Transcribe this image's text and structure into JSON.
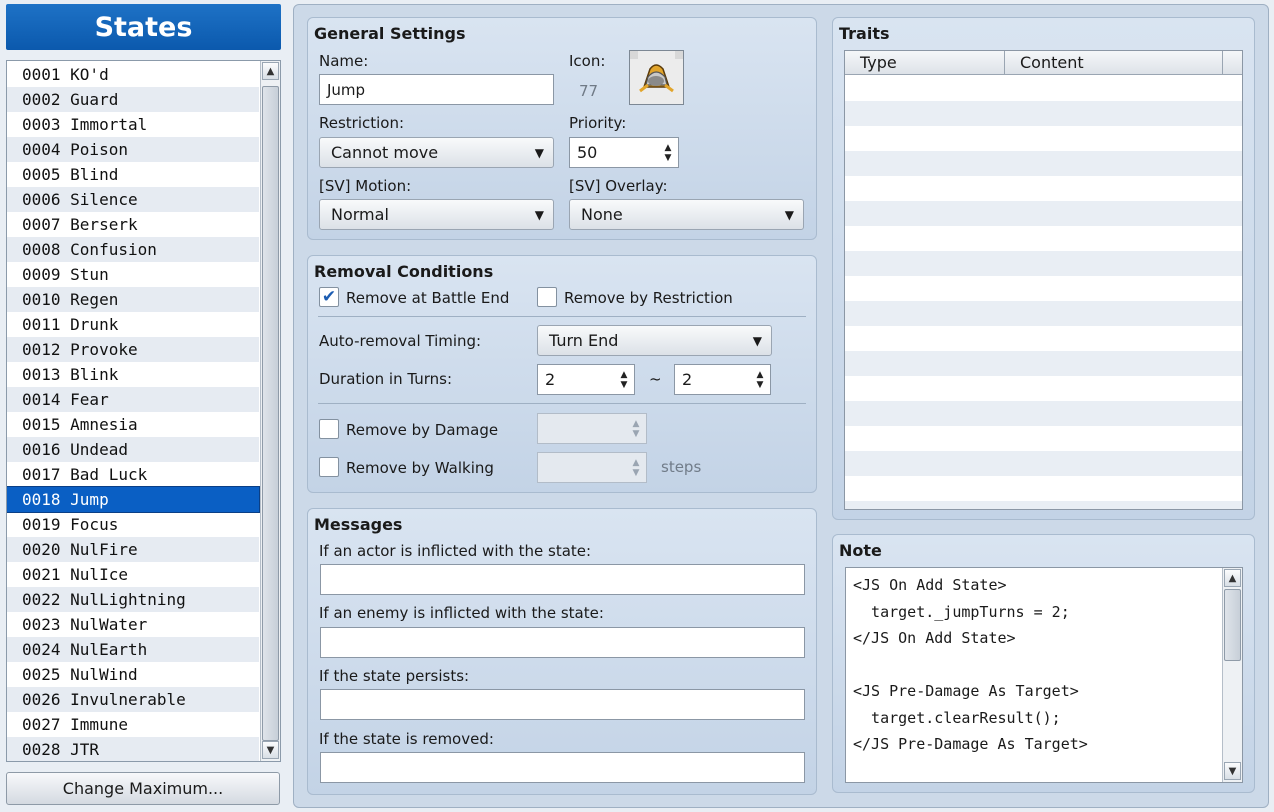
{
  "list": {
    "title": "States",
    "items": [
      "0001 KO'd",
      "0002 Guard",
      "0003 Immortal",
      "0004 Poison",
      "0005 Blind",
      "0006 Silence",
      "0007 Berserk",
      "0008 Confusion",
      "0009 Stun",
      "0010 Regen",
      "0011 Drunk",
      "0012 Provoke",
      "0013 Blink",
      "0014 Fear",
      "0015 Amnesia",
      "0016 Undead",
      "0017 Bad Luck",
      "0018 Jump",
      "0019 Focus",
      "0020 NulFire",
      "0021 NulIce",
      "0022 NulLightning",
      "0023 NulWater",
      "0024 NulEarth",
      "0025 NulWind",
      "0026 Invulnerable",
      "0027 Immune",
      "0028 JTR"
    ],
    "selected_index": 17,
    "change_max_label": "Change Maximum..."
  },
  "general": {
    "title": "General Settings",
    "name_label": "Name:",
    "name_value": "Jump",
    "icon_label": "Icon:",
    "icon_index": "77",
    "restriction_label": "Restriction:",
    "restriction_value": "Cannot move",
    "priority_label": "Priority:",
    "priority_value": "50",
    "motion_label": "[SV] Motion:",
    "motion_value": "Normal",
    "overlay_label": "[SV] Overlay:",
    "overlay_value": "None"
  },
  "removal": {
    "title": "Removal Conditions",
    "battle_end_label": "Remove at Battle End",
    "battle_end_checked": true,
    "restriction_label": "Remove by Restriction",
    "restriction_checked": false,
    "timing_label": "Auto-removal Timing:",
    "timing_value": "Turn End",
    "duration_label": "Duration in Turns:",
    "duration_min": "2",
    "duration_max": "2",
    "tilde": "~",
    "damage_label": "Remove by Damage",
    "damage_checked": false,
    "walking_label": "Remove by Walking",
    "walking_checked": false,
    "steps_label": "steps"
  },
  "messages": {
    "title": "Messages",
    "actor_label": "If an actor is inflicted with the state:",
    "actor_value": "",
    "enemy_label": "If an enemy is inflicted with the state:",
    "enemy_value": "",
    "persists_label": "If the state persists:",
    "persists_value": "",
    "removed_label": "If the state is removed:",
    "removed_value": ""
  },
  "traits": {
    "title": "Traits",
    "col_type": "Type",
    "col_content": "Content"
  },
  "note": {
    "title": "Note",
    "lines": [
      "<JS On Add State>",
      "  target._jumpTurns = 2;",
      "</JS On Add State>",
      "",
      "<JS Pre-Damage As Target>",
      "  target.clearResult();",
      "</JS Pre-Damage As Target>"
    ]
  },
  "colors": {
    "selection": "#0a5fc4",
    "header": "#0b59ad",
    "panel": "#ccd9e8"
  }
}
